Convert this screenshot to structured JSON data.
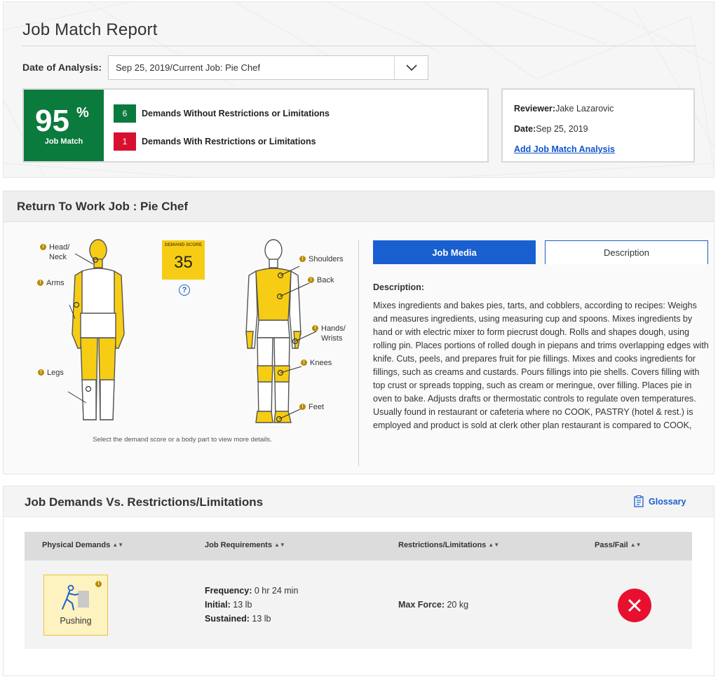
{
  "header": {
    "title": "Job Match Report",
    "date_label": "Date of Analysis:",
    "date_value": "Sep 25, 2019/Current Job: Pie Chef"
  },
  "match": {
    "percent": "95",
    "percent_sign": "%",
    "label": "Job Match",
    "without_count": "6",
    "without_label": "Demands Without Restrictions or Limitations",
    "with_count": "1",
    "with_label": "Demands With Restrictions or Limitations",
    "colors": {
      "green": "#0b7a3d",
      "red": "#d8102f"
    }
  },
  "reviewer": {
    "reviewer_label": "Reviewer:",
    "reviewer_name": "Jake Lazarovic",
    "date_label": "Date:",
    "date_value": "Sep 25, 2019",
    "add_link": "Add Job Match Analysis"
  },
  "rtw": {
    "title": "Return To Work Job : Pie Chef",
    "demand_score_label": "DEMAND SCORE",
    "demand_score_value": "35",
    "help_icon": "question-circle-icon",
    "body_parts": {
      "head_neck": "Head/\nNeck",
      "arms": "Arms",
      "legs": "Legs",
      "shoulders": "Shoulders",
      "back": "Back",
      "hands_wrists": "Hands/\nWrists",
      "knees": "Knees",
      "feet": "Feet"
    },
    "hint": "Select the demand score or a body part to view more details.",
    "tabs": {
      "media": "Job Media",
      "description": "Description"
    },
    "description_heading": "Description:",
    "description_text": "Mixes ingredients and bakes pies, tarts, and cobblers, according to recipes: Weighs and measures ingredients, using measuring cup and spoons. Mixes ingredients by hand or with electric mixer to form piecrust dough. Rolls and shapes dough, using rolling pin. Places portions of rolled dough in piepans and trims overlapping edges with knife. Cuts, peels, and prepares fruit for pie fillings. Mixes and cooks ingredients for fillings, such as creams and custards. Pours fillings into pie shells. Covers filling with top crust or spreads topping, such as cream or meringue, over filling. Places pie in oven to bake. Adjusts drafts or thermostatic controls to regulate oven temperatures. Usually found in restaurant or cafeteria where no COOK, PASTRY (hotel & rest.) is employed and product is sold at clerk other plan restaurant is compared to COOK, PAS",
    "highlight_color": "#f6cd14"
  },
  "demands": {
    "title": "Job Demands Vs. Restrictions/Limitations",
    "glossary": "Glossary",
    "columns": [
      "Physical Demands",
      "Job Requirements",
      "Restrictions/Limitations",
      "Pass/Fail"
    ],
    "rows": [
      {
        "demand": "Pushing",
        "icon": "pushing-person-icon",
        "freq_label": "Frequency:",
        "freq_value": "0 hr 24 min",
        "initial_label": "Initial:",
        "initial_value": "13 lb",
        "sustained_label": "Sustained:",
        "sustained_value": "13 lb",
        "restriction_label": "Max Force:",
        "restriction_value": "20 kg",
        "result_icon": "fail-x-icon"
      }
    ]
  }
}
